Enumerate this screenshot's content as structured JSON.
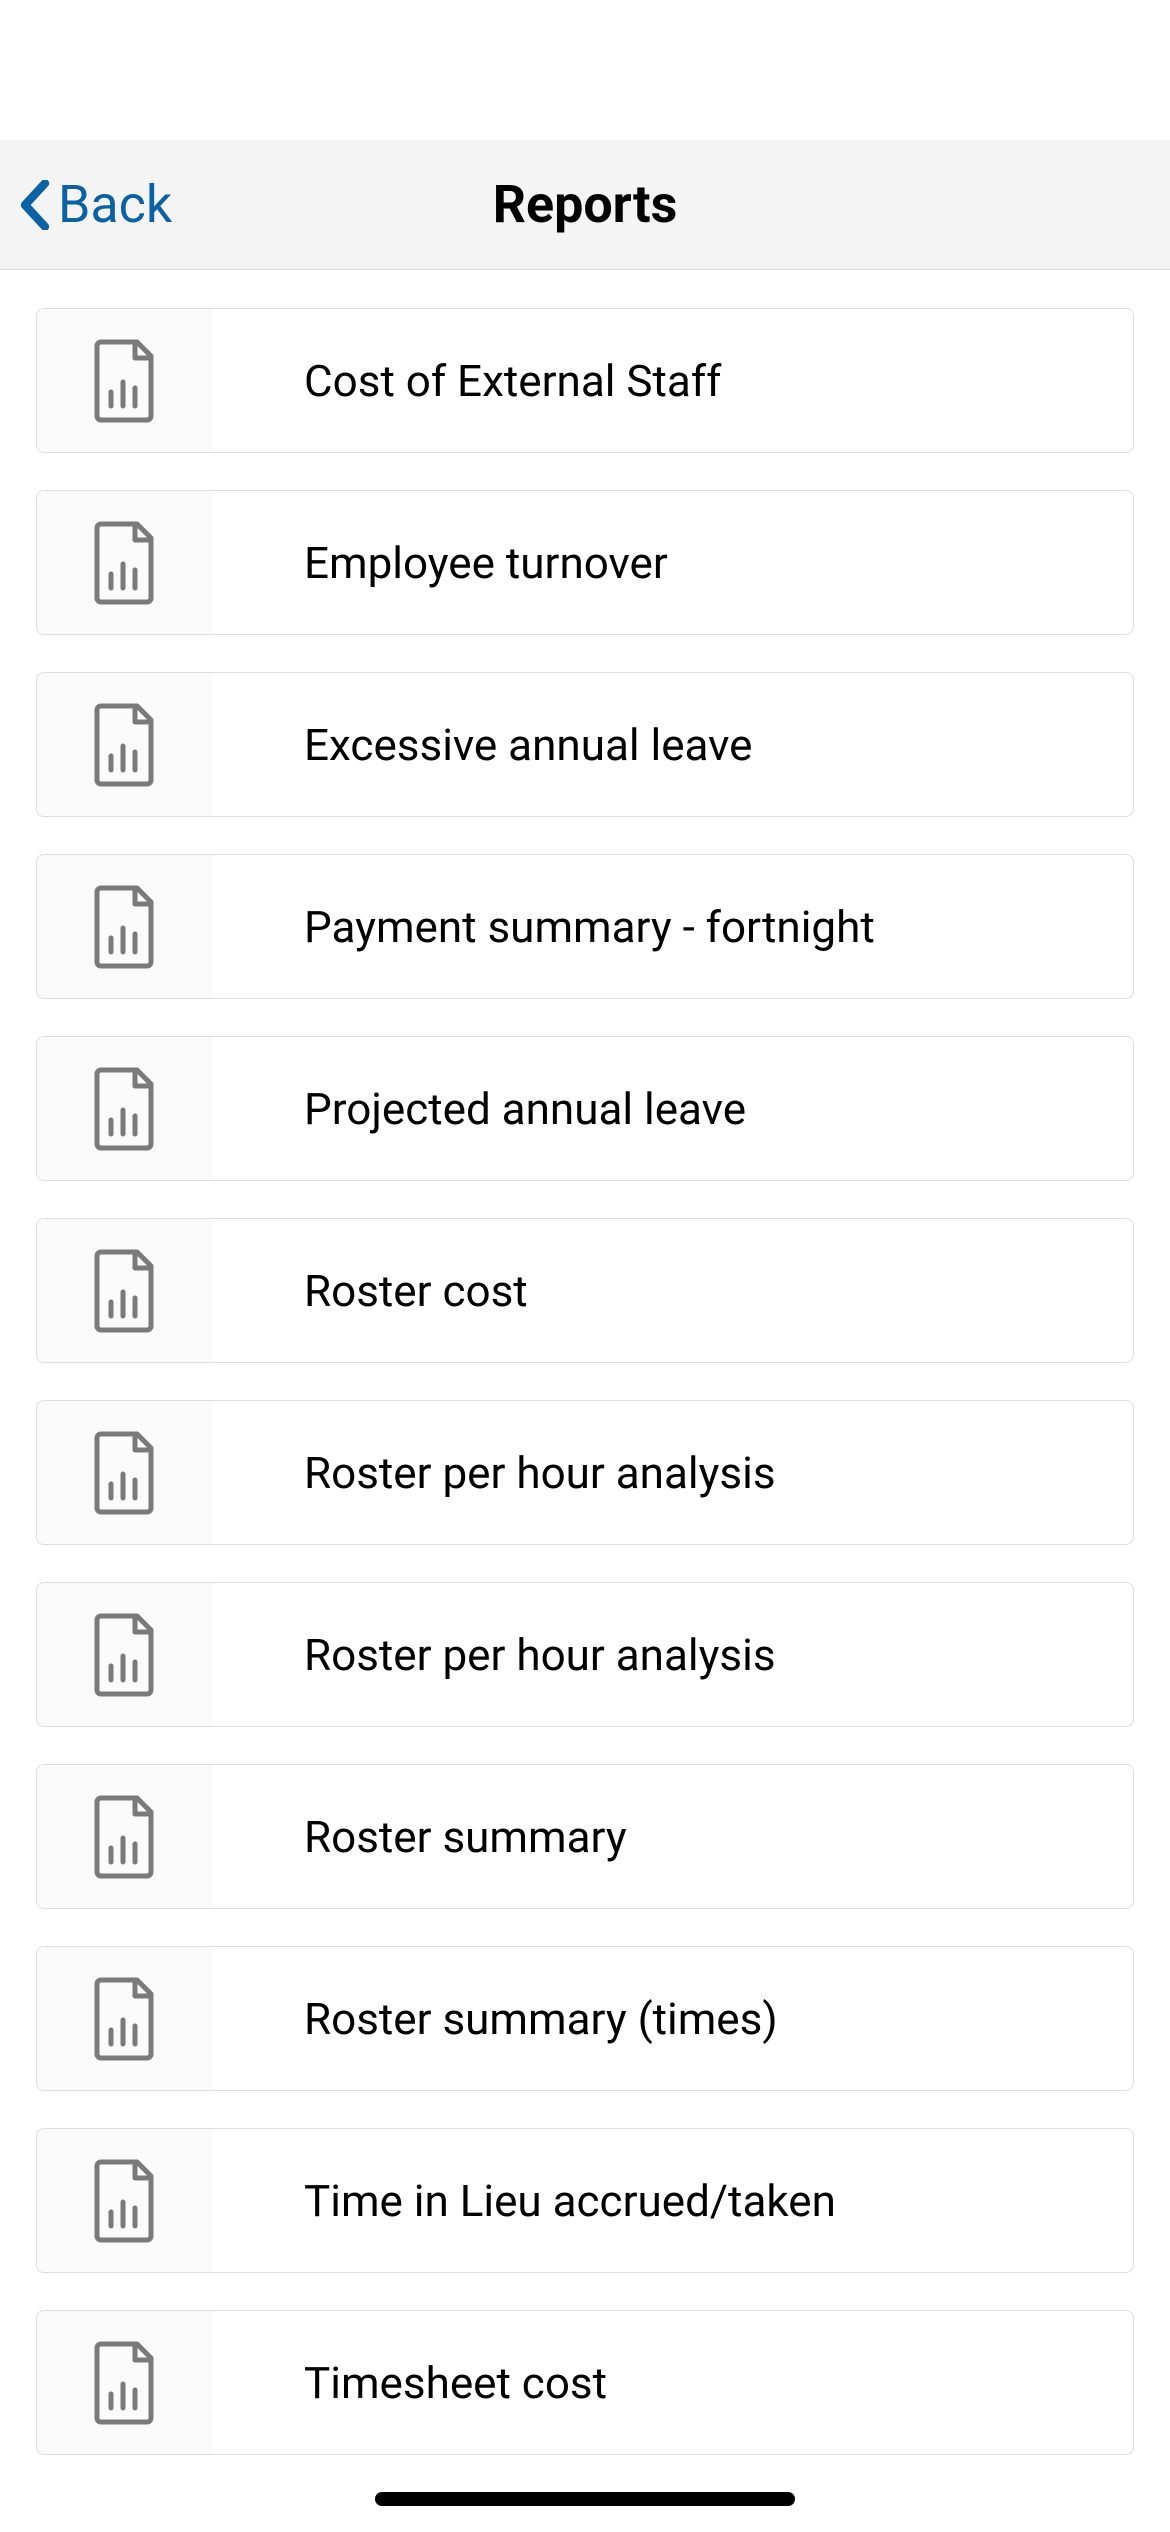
{
  "nav": {
    "back_label": "Back",
    "title": "Reports"
  },
  "reports": [
    {
      "label": "Cost of External Staff"
    },
    {
      "label": "Employee turnover"
    },
    {
      "label": "Excessive annual leave"
    },
    {
      "label": "Payment summary - fortnight"
    },
    {
      "label": "Projected annual leave"
    },
    {
      "label": "Roster cost"
    },
    {
      "label": "Roster per hour analysis"
    },
    {
      "label": "Roster per hour analysis"
    },
    {
      "label": "Roster summary"
    },
    {
      "label": "Roster summary (times)"
    },
    {
      "label": "Time in Lieu accrued/taken"
    },
    {
      "label": "Timesheet cost"
    }
  ]
}
